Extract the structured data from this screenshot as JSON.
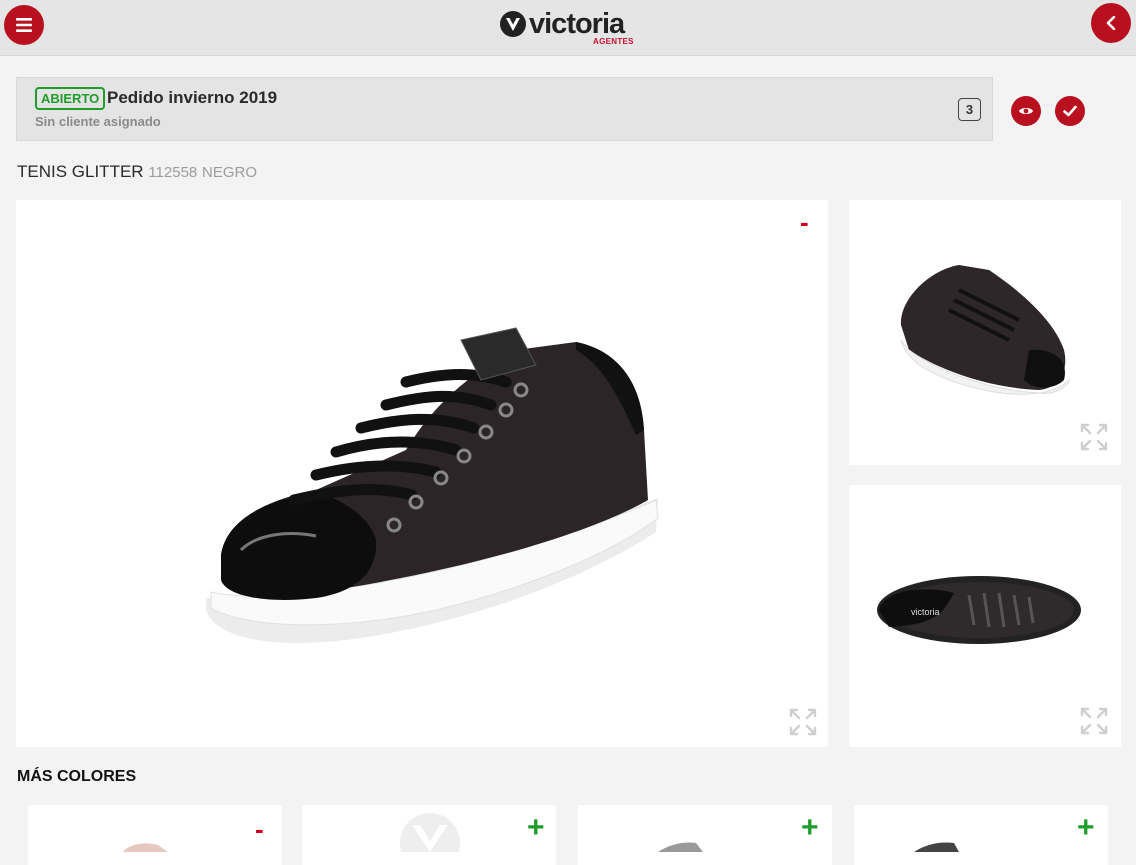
{
  "header": {
    "logo_text": "victoria",
    "logo_sub": "AGENTES",
    "menu_icon": "hamburger-menu-icon",
    "back_icon": "chevron-left-icon"
  },
  "order": {
    "status": "ABIERTO",
    "title": "Pedido invierno 2019",
    "client": "Sin cliente asignado",
    "count": "3",
    "view_icon": "eye-icon",
    "confirm_icon": "check-icon"
  },
  "product": {
    "name": "TENIS GLITTER",
    "code": "112558",
    "color": "NEGRO"
  },
  "gallery": {
    "main_remove": "-",
    "expand_icon": "expand-arrows-icon"
  },
  "more_colors": {
    "title": "MÁS COLORES",
    "cards": [
      {
        "action": "-"
      },
      {
        "action": "+"
      },
      {
        "action": "+"
      },
      {
        "action": "+"
      }
    ]
  },
  "colors": {
    "brand_red": "#b8101f",
    "status_green": "#1f9d2b",
    "remove_red": "#d0021b"
  }
}
